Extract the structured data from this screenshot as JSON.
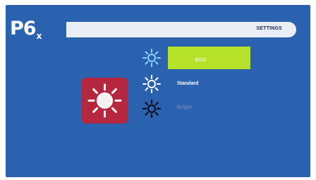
{
  "brand": {
    "main": "P6",
    "sub": "x"
  },
  "header": {
    "title": "SETTINGS"
  },
  "options": [
    {
      "label": "ECO",
      "selected": true,
      "icon": "sun-icon"
    },
    {
      "label": "Standard",
      "selected": false,
      "icon": "sun-icon"
    },
    {
      "label": "Bright",
      "selected": false,
      "icon": "sun-icon"
    }
  ],
  "colors": {
    "background": "#2a62b0",
    "selection": "#b7e22c",
    "tile": "#b5273e",
    "header_bar": "#e9edf4"
  }
}
